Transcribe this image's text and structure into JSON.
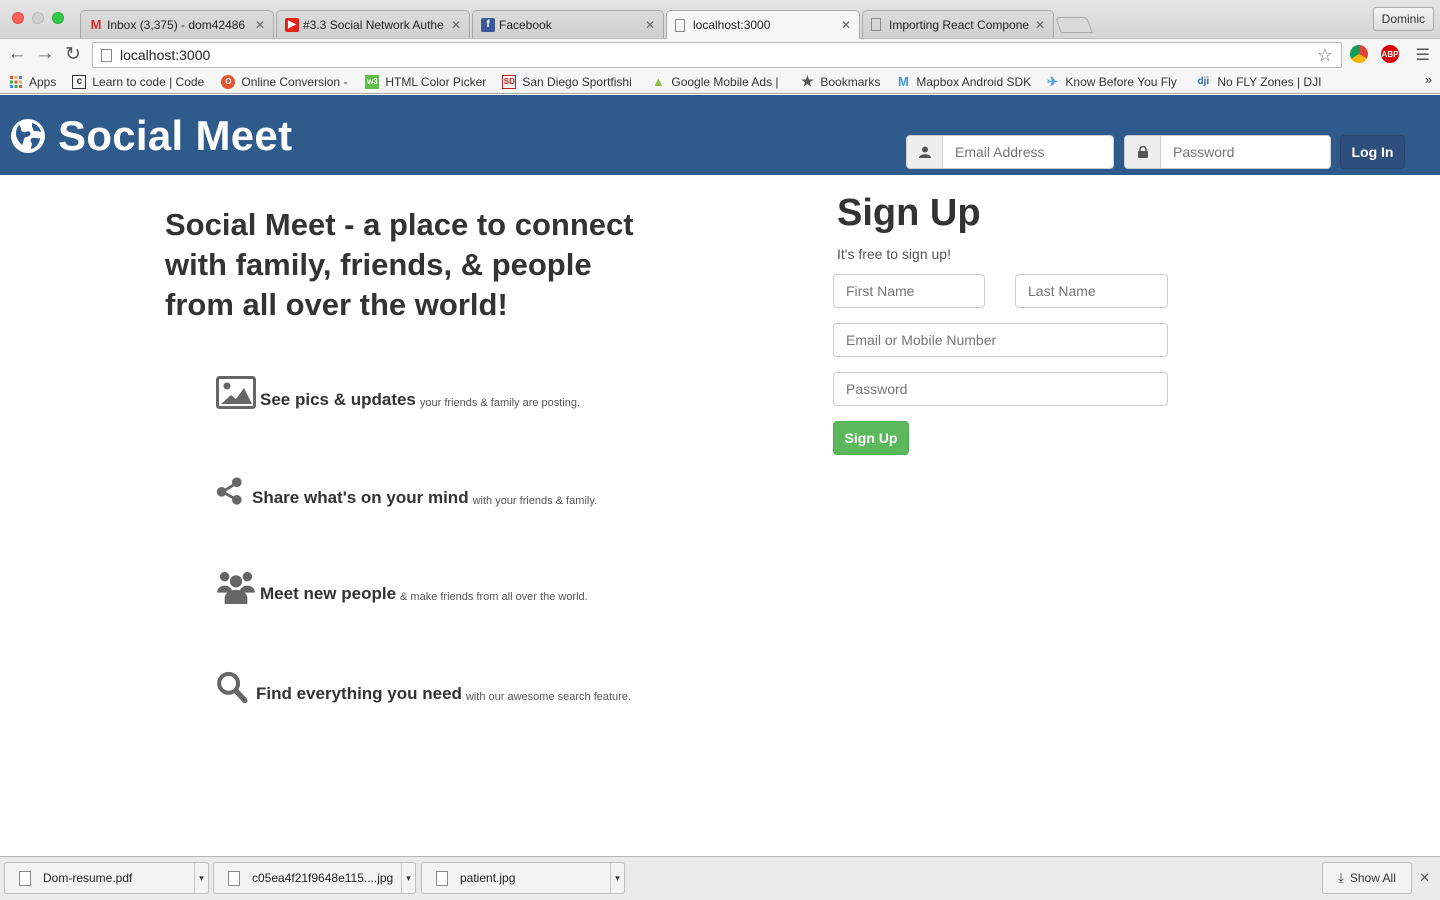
{
  "browser": {
    "tabs": [
      {
        "label": "Inbox (3,375) - dom42486",
        "icon": "gmail-icon",
        "color": "#d93025"
      },
      {
        "label": "#3.3 Social Network Authe",
        "icon": "youtube-icon",
        "color": "#e62117"
      },
      {
        "label": "Facebook",
        "icon": "facebook-icon",
        "color": "#3b5998"
      },
      {
        "label": "localhost:3000",
        "icon": "page-icon",
        "color": "#ffffff",
        "active": true
      },
      {
        "label": "Importing React Componen",
        "icon": "page-icon",
        "color": "#ffffff"
      }
    ],
    "profile": "Dominic",
    "address": "localhost:3000",
    "extensions": {
      "abp_label": "ABP"
    },
    "bookmarks": [
      {
        "label": "Apps",
        "icon": "apps-grid-icon"
      },
      {
        "label": "Learn to code | Code",
        "icon": "codecademy-icon"
      },
      {
        "label": "Online Conversion -",
        "icon": "conversion-icon"
      },
      {
        "label": "HTML Color Picker",
        "icon": "w3-icon"
      },
      {
        "label": "San Diego Sportfishi",
        "icon": "sportfishing-icon"
      },
      {
        "label": "Google Mobile Ads |",
        "icon": "android-icon"
      },
      {
        "label": "Bookmarks",
        "icon": "star-icon"
      },
      {
        "label": "Mapbox Android SDK",
        "icon": "mapbox-icon"
      },
      {
        "label": "Know Before You Fly",
        "icon": "drone-icon"
      },
      {
        "label": "No FLY Zones | DJI",
        "icon": "dji-icon"
      }
    ],
    "bookmarks_more": "»"
  },
  "app": {
    "brand": "Social Meet",
    "login": {
      "email_placeholder": "Email Address",
      "password_placeholder": "Password",
      "button": "Log In"
    },
    "headline": "Social Meet - a place to connect with family, friends, & people from all over the world!",
    "features": [
      {
        "icon": "image-icon",
        "title": "See pics & updates",
        "subtitle": "your friends & family are posting."
      },
      {
        "icon": "share-icon",
        "title": "Share what's on your mind",
        "subtitle": "with your friends & family."
      },
      {
        "icon": "users-icon",
        "title": "Meet new people",
        "subtitle": "& make friends from all over the world."
      },
      {
        "icon": "search-icon",
        "title": "Find everything you need",
        "subtitle": "with our awesome search feature."
      }
    ],
    "signup": {
      "title": "Sign Up",
      "subtitle": "It's free to sign up!",
      "first_name_placeholder": "First Name",
      "last_name_placeholder": "Last Name",
      "email_placeholder": "Email or Mobile Number",
      "password_placeholder": "Password",
      "button": "Sign Up"
    },
    "colors": {
      "navbar": "#2e5a8c",
      "login_button": "#2e4f7e",
      "signup_button": "#5cb85c"
    }
  },
  "downloads": {
    "items": [
      {
        "name": "Dom-resume.pdf"
      },
      {
        "name": "c05ea4f21f9648e115....jpg"
      },
      {
        "name": "patient.jpg"
      }
    ],
    "show_all": "Show All"
  }
}
